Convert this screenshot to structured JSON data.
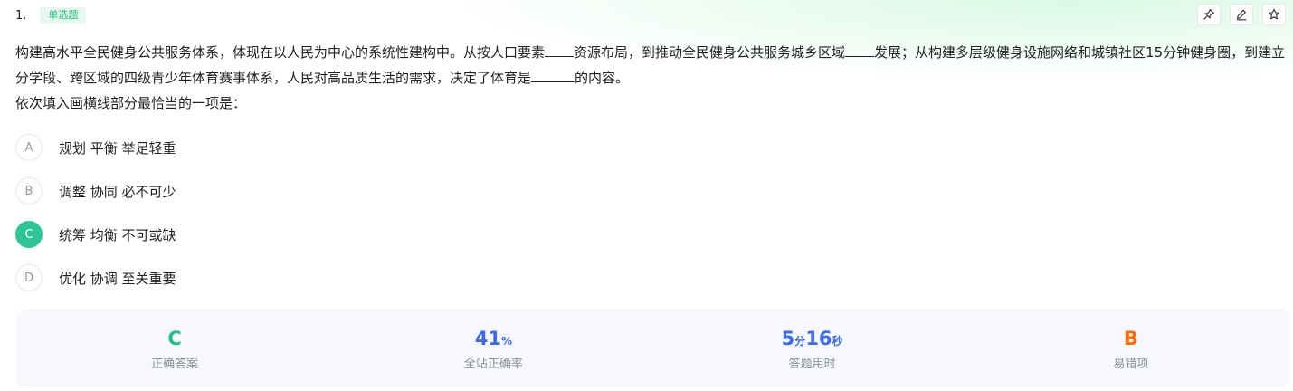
{
  "question": {
    "number": "1.",
    "type_tag": "单选题",
    "stem": {
      "part1": "构建高水平全民健身公共服务体系，体现在以人民为中心的系统性建构中。从按人口要素",
      "part2": "资源布局，到推动全民健身公共服务城乡区域",
      "part3": "发展；从构建多层级健身设施网络和城镇社区15分钟健身圈，到建立分学段、跨区域的四级青少年体育赛事体系，人民对高品质生活的需求，决定了体育是",
      "part4": "的内容。",
      "prompt": "依次填入画横线部分最恰当的一项是："
    }
  },
  "toolbar": {
    "icons": [
      "pin-icon",
      "edit-icon",
      "star-icon"
    ]
  },
  "options": [
    {
      "letter": "A",
      "text": "规划 平衡 举足轻重"
    },
    {
      "letter": "B",
      "text": "调整 协同 必不可少"
    },
    {
      "letter": "C",
      "text": "统筹 均衡 不可或缺",
      "selected": true
    },
    {
      "letter": "D",
      "text": "优化 协调 至关重要"
    }
  ],
  "stats": {
    "correct_answer": {
      "value": "C",
      "label": "正确答案",
      "color": "#22c08b"
    },
    "accuracy": {
      "value": "41",
      "unit": "%",
      "label": "全站正确率",
      "color": "#3d6af0"
    },
    "time": {
      "min": "5",
      "min_unit": "分",
      "sec": "16",
      "sec_unit": "秒",
      "label": "答题用时",
      "color": "#3d6af0"
    },
    "common_wrong": {
      "value": "B",
      "label": "易错项",
      "color": "#ff6a00"
    }
  }
}
